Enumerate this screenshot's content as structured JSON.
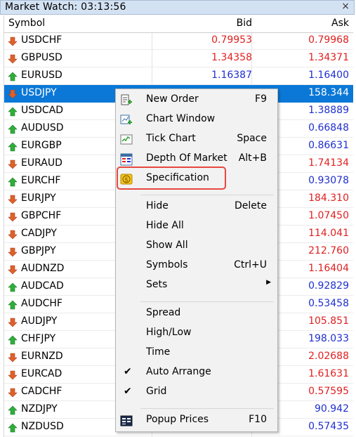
{
  "window": {
    "title": "Market Watch: 03:13:56",
    "close_glyph": "×"
  },
  "columns": {
    "symbol": "Symbol",
    "bid": "Bid",
    "ask": "Ask"
  },
  "colors": {
    "down": "#e02020",
    "up": "#1f2fd0",
    "selected": "#0b78d7",
    "highlight": "#e8473f"
  },
  "rows": [
    {
      "symbol": "USDCHF",
      "bid": "0.79953",
      "ask": "0.79968",
      "dir": "down",
      "selected": false
    },
    {
      "symbol": "GBPUSD",
      "bid": "1.34358",
      "ask": "1.34371",
      "dir": "down",
      "selected": false
    },
    {
      "symbol": "EURUSD",
      "bid": "1.16387",
      "ask": "1.16400",
      "dir": "up",
      "selected": false
    },
    {
      "symbol": "USDJPY",
      "bid": "",
      "ask": "158.344",
      "dir": "down",
      "selected": true
    },
    {
      "symbol": "USDCAD",
      "bid": "",
      "ask": "1.38889",
      "dir": "up",
      "selected": false
    },
    {
      "symbol": "AUDUSD",
      "bid": "",
      "ask": "0.66848",
      "dir": "up",
      "selected": false
    },
    {
      "symbol": "EURGBP",
      "bid": "",
      "ask": "0.86631",
      "dir": "up",
      "selected": false
    },
    {
      "symbol": "EURAUD",
      "bid": "",
      "ask": "1.74134",
      "dir": "down",
      "selected": false
    },
    {
      "symbol": "EURCHF",
      "bid": "",
      "ask": "0.93078",
      "dir": "up",
      "selected": false
    },
    {
      "symbol": "EURJPY",
      "bid": "",
      "ask": "184.310",
      "dir": "down",
      "selected": false
    },
    {
      "symbol": "GBPCHF",
      "bid": "",
      "ask": "1.07450",
      "dir": "down",
      "selected": false
    },
    {
      "symbol": "CADJPY",
      "bid": "",
      "ask": "114.041",
      "dir": "down",
      "selected": false
    },
    {
      "symbol": "GBPJPY",
      "bid": "",
      "ask": "212.760",
      "dir": "down",
      "selected": false
    },
    {
      "symbol": "AUDNZD",
      "bid": "",
      "ask": "1.16404",
      "dir": "down",
      "selected": false
    },
    {
      "symbol": "AUDCAD",
      "bid": "",
      "ask": "0.92829",
      "dir": "up",
      "selected": false
    },
    {
      "symbol": "AUDCHF",
      "bid": "",
      "ask": "0.53458",
      "dir": "up",
      "selected": false
    },
    {
      "symbol": "AUDJPY",
      "bid": "",
      "ask": "105.851",
      "dir": "down",
      "selected": false
    },
    {
      "symbol": "CHFJPY",
      "bid": "",
      "ask": "198.033",
      "dir": "up",
      "selected": false
    },
    {
      "symbol": "EURNZD",
      "bid": "",
      "ask": "2.02688",
      "dir": "down",
      "selected": false
    },
    {
      "symbol": "EURCAD",
      "bid": "",
      "ask": "1.61631",
      "dir": "down",
      "selected": false
    },
    {
      "symbol": "CADCHF",
      "bid": "",
      "ask": "0.57595",
      "dir": "down",
      "selected": false
    },
    {
      "symbol": "NZDJPY",
      "bid": "",
      "ask": "90.942",
      "dir": "up",
      "selected": false
    },
    {
      "symbol": "NZDUSD",
      "bid": "",
      "ask": "0.57435",
      "dir": "up",
      "selected": false
    }
  ],
  "context_menu": {
    "new_order": {
      "label": "New Order",
      "key": "F9",
      "icon": "new-order-icon"
    },
    "chart_window": {
      "label": "Chart Window",
      "icon": "chart-window-icon"
    },
    "tick_chart": {
      "label": "Tick Chart",
      "key": "Space",
      "icon": "tick-chart-icon"
    },
    "depth_of_market": {
      "label": "Depth Of Market",
      "key": "Alt+B",
      "icon": "depth-of-market-icon"
    },
    "specification": {
      "label": "Specification",
      "icon": "dollar-coin-icon"
    },
    "hide": {
      "label": "Hide",
      "key": "Delete"
    },
    "hide_all": {
      "label": "Hide All"
    },
    "show_all": {
      "label": "Show All"
    },
    "symbols": {
      "label": "Symbols",
      "key": "Ctrl+U"
    },
    "sets": {
      "label": "Sets",
      "submenu_glyph": "▶"
    },
    "spread": {
      "label": "Spread"
    },
    "high_low": {
      "label": "High/Low"
    },
    "time": {
      "label": "Time"
    },
    "auto_arrange": {
      "label": "Auto Arrange",
      "checked": true,
      "check_glyph": "✔"
    },
    "grid": {
      "label": "Grid",
      "checked": true,
      "check_glyph": "✔"
    },
    "popup_prices": {
      "label": "Popup Prices",
      "key": "F10",
      "icon": "popup-prices-icon"
    }
  }
}
